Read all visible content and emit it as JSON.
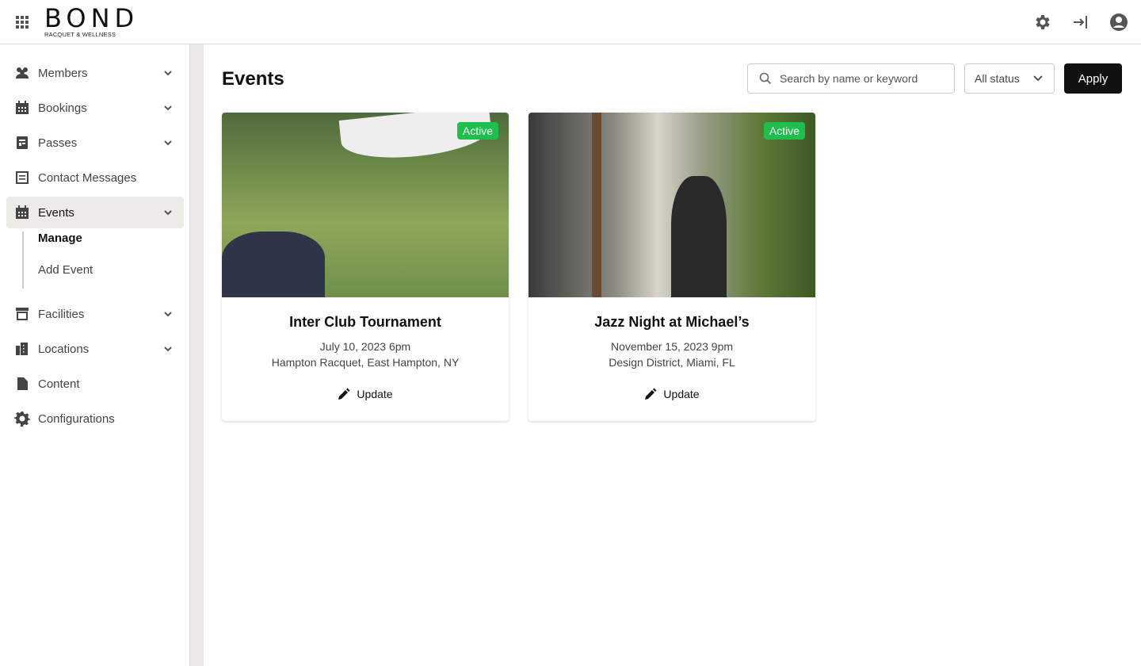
{
  "header": {
    "logo_text": "BOND",
    "logo_tagline": "RACQUET & WELLNESS"
  },
  "sidebar": {
    "items": [
      {
        "label": "Members",
        "icon": "members-icon",
        "chevron": true
      },
      {
        "label": "Bookings",
        "icon": "calendar-icon",
        "chevron": true
      },
      {
        "label": "Passes",
        "icon": "pass-icon",
        "chevron": true
      },
      {
        "label": "Contact Messages",
        "icon": "message-icon",
        "chevron": false
      },
      {
        "label": "Events",
        "icon": "calendar-icon",
        "chevron": true,
        "active": true
      },
      {
        "label": "Facilities",
        "icon": "store-icon",
        "chevron": true
      },
      {
        "label": "Locations",
        "icon": "building-icon",
        "chevron": true
      },
      {
        "label": "Content",
        "icon": "document-icon",
        "chevron": false
      },
      {
        "label": "Configurations",
        "icon": "gear-icon",
        "chevron": false
      }
    ],
    "events_sub": [
      {
        "label": "Manage",
        "current": true
      },
      {
        "label": "Add Event"
      }
    ]
  },
  "main": {
    "title": "Events",
    "search_placeholder": "Search by name or keyword",
    "status_select": "All status",
    "apply_label": "Apply",
    "cards": [
      {
        "title": "Inter Club Tournament",
        "date": "July 10, 2023 6pm",
        "location": "Hampton Racquet, East Hampton, NY",
        "status": "Active",
        "action": "Update"
      },
      {
        "title": "Jazz Night at Michael’s",
        "date": "November 15, 2023 9pm",
        "location": "Design District, Miami, FL",
        "status": "Active",
        "action": "Update"
      }
    ]
  },
  "colors": {
    "active_badge": "#1fbf4d",
    "apply_button": "#111111",
    "sidebar_active": "#edebe7"
  }
}
